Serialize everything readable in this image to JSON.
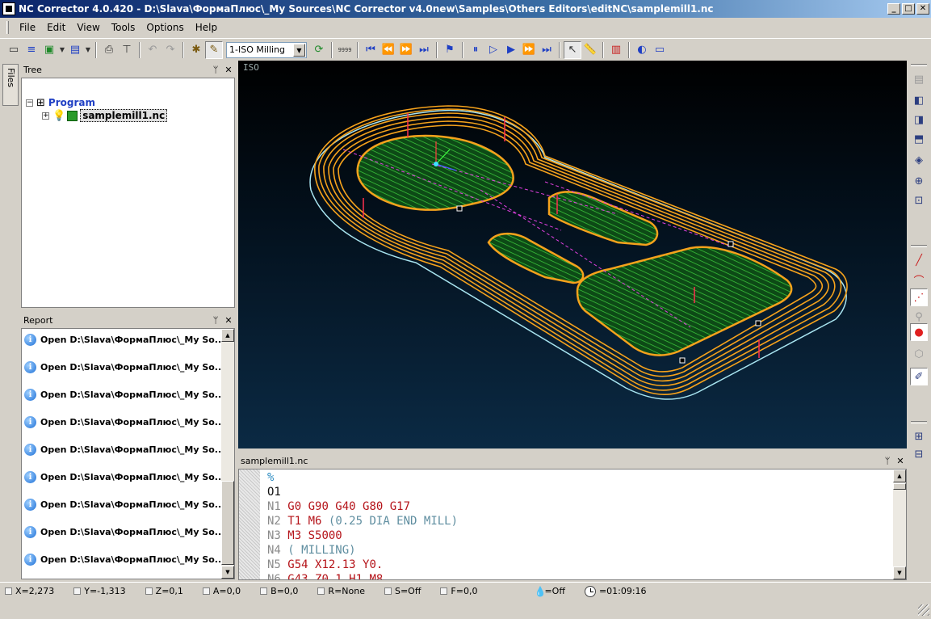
{
  "window": {
    "title": "NC Corrector 4.0.420 - D:\\Slava\\ФормаПлюс\\_My Sources\\NC Corrector v4.0new\\Samples\\Others Editors\\editNC\\samplemill1.nc",
    "minimize": "_",
    "maximize": "□",
    "close": "✕"
  },
  "menu": [
    "File",
    "Edit",
    "View",
    "Tools",
    "Options",
    "Help"
  ],
  "toolbar": {
    "mode_value": "1-ISO Milling",
    "counter_label": "9999"
  },
  "files_tab": "Files",
  "tree": {
    "title": "Tree",
    "root": "Program",
    "file": "samplemill1.nc"
  },
  "report": {
    "title": "Report",
    "items": [
      "Open D:\\Slava\\ФормаПлюс\\_My So...",
      "Open D:\\Slava\\ФормаПлюс\\_My So...",
      "Open D:\\Slava\\ФормаПлюс\\_My So...",
      "Open D:\\Slava\\ФормаПлюс\\_My So...",
      "Open D:\\Slava\\ФормаПлюс\\_My So...",
      "Open D:\\Slava\\ФормаПлюс\\_My So...",
      "Open D:\\Slava\\ФормаПлюс\\_My So...",
      "Open D:\\Slava\\ФормаПлюс\\_My So...",
      "Open D:\\Slava\\ФормаПлюс\\_My So..."
    ]
  },
  "viewport": {
    "view_mode": "ISO",
    "colors": {
      "toolpath": "#f5a21c",
      "pocket": "#1e8c1e",
      "outline": "#a8e4f0",
      "rapid": "#e040e0"
    }
  },
  "panel_buttons": {
    "pin": "ᛘ",
    "close": "✕"
  },
  "editor": {
    "title": "samplemill1.nc",
    "lines": [
      {
        "num": "",
        "code": "%",
        "comment": ""
      },
      {
        "num": "",
        "code": "O1",
        "comment": ""
      },
      {
        "num": "N1",
        "code": "G0 G90 G40 G80 G17",
        "comment": ""
      },
      {
        "num": "N2",
        "code": "T1 M6",
        "comment": "(0.25 DIA END MILL)"
      },
      {
        "num": "N3",
        "code": "M3 S5000",
        "comment": ""
      },
      {
        "num": "N4",
        "code": "",
        "comment": "( MILLING)"
      },
      {
        "num": "N5",
        "code": "G54 X12.13 Y0.",
        "comment": ""
      },
      {
        "num": "N6",
        "code": "G43 Z0.1 H1 M8",
        "comment": ""
      }
    ]
  },
  "status": {
    "x": "X=2,273",
    "y": "Y=-1,313",
    "z": "Z=0,1",
    "a": "A=0,0",
    "b": "B=0,0",
    "r": "R=None",
    "s": "S=Off",
    "f": "F=0,0",
    "coolant": "=Off",
    "time": "=01:09:16"
  }
}
